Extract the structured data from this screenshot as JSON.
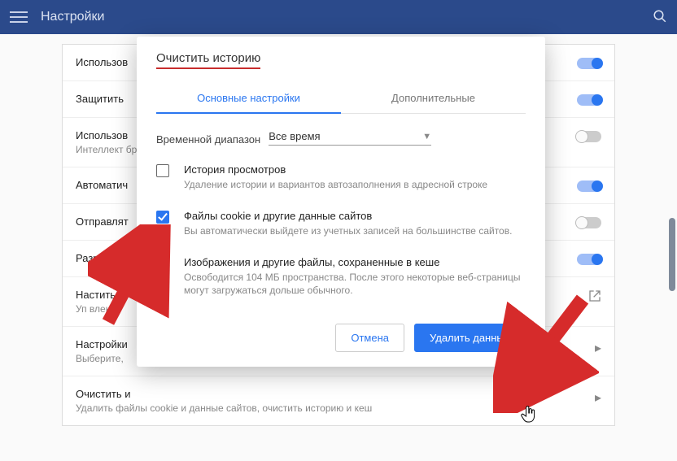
{
  "header": {
    "title": "Настройки"
  },
  "settings": {
    "rows": [
      {
        "title": "Использов",
        "sub": "",
        "control": "toggle-on"
      },
      {
        "title": "Защитить",
        "sub": "",
        "control": "toggle-on"
      },
      {
        "title": "Использов",
        "sub": "Интеллект\nбраузере,",
        "control": "toggle-off"
      },
      {
        "title": "Автоматич",
        "sub": "",
        "control": "toggle-on"
      },
      {
        "title": "Отправлят",
        "sub": "",
        "control": "toggle-off"
      },
      {
        "title": "Разреши",
        "sub": "",
        "control": "toggle-on"
      },
      {
        "title": "Настить",
        "sub": "Уп влени",
        "control": "external"
      },
      {
        "title": "Настройки",
        "sub": "Выберите,",
        "control": "chevron"
      },
      {
        "title": "Очистить и",
        "sub": "Удалить файлы cookie и данные сайтов, очистить историю и кеш",
        "control": "chevron"
      }
    ]
  },
  "modal": {
    "title": "Очистить историю",
    "tabs": {
      "active": "Основные настройки",
      "inactive": "Дополнительные"
    },
    "time_label": "Временной диапазон",
    "time_value": "Все время",
    "options": [
      {
        "checked": false,
        "title": "История просмотров",
        "sub": "Удаление истории и вариантов автозаполнения в адресной строке"
      },
      {
        "checked": true,
        "title": "Файлы cookie и другие данные сайтов",
        "sub": "Вы автоматически выйдете из учетных записей на большинстве сайтов."
      },
      {
        "checked": false,
        "title": "Изображения и другие файлы, сохраненные в кеше",
        "sub": "Освободится 104 МБ пространства. После этого некоторые веб-страницы могут загружаться дольше обычного."
      }
    ],
    "cancel": "Отмена",
    "confirm": "Удалить данные"
  }
}
